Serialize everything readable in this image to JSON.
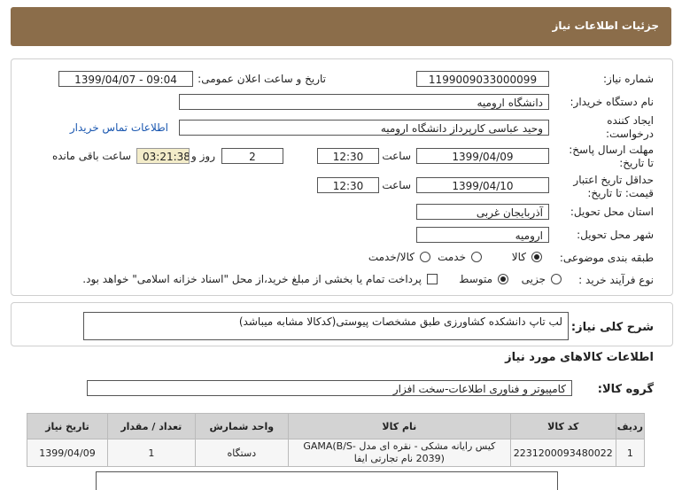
{
  "page": {
    "title": "جزئیات اطلاعات نیاز"
  },
  "form": {
    "need_number": {
      "label": "شماره نیاز:",
      "value": "1199009033000099"
    },
    "announce_datetime": {
      "label": "تاریخ و ساعت اعلان عمومی:",
      "value": "1399/04/07 - 09:04"
    },
    "buyer_org": {
      "label": "نام دستگاه خریدار:",
      "value": "دانشگاه ارومیه"
    },
    "requester": {
      "label_line1": "ایجاد کننده",
      "label_line2": "درخواست:",
      "value": "وحید عباسی کارپرداز دانشگاه ارومیه"
    },
    "contact_link": "اطلاعات تماس خریدار",
    "reply_deadline": {
      "label_line1": "مهلت ارسال پاسخ:",
      "label_line2": "تا تاریخ:",
      "date": "1399/04/09",
      "time_label": "ساعت",
      "time": "12:30",
      "days": "2",
      "days_label": "روز و",
      "remaining": "03:21:38",
      "remaining_label": "ساعت باقی مانده"
    },
    "price_validity": {
      "label_line1": "حداقل تاریخ اعتبار",
      "label_line2": "قیمت: تا تاریخ:",
      "date": "1399/04/10",
      "time_label": "ساعت",
      "time": "12:30"
    },
    "province": {
      "label": "استان محل تحویل:",
      "value": "آذربایجان غربی"
    },
    "city": {
      "label": "شهر محل تحویل:",
      "value": "ارومیه"
    },
    "category": {
      "label": "طبقه بندی موضوعی:",
      "options": [
        "کالا",
        "خدمت",
        "کالا/خدمت"
      ],
      "selected": "کالا"
    },
    "purchase_type": {
      "label": "نوع فرآیند خرید :",
      "options": [
        "جزیی",
        "متوسط"
      ],
      "selected": "متوسط",
      "note": "پرداخت تمام یا بخشی از مبلغ خرید،از محل \"اسناد خزانه اسلامی\" خواهد بود."
    }
  },
  "summary": {
    "label": "شرح کلی نیاز:",
    "value": "لب تاپ دانشکده کشاورزی طبق مشخصات پیوستی(کدکالا مشابه میباشد)"
  },
  "goods_section": {
    "title": "اطلاعات کالاهای مورد نیاز",
    "group_label": "گروه کالا:",
    "group_value": "کامپیوتر و فناوری اطلاعات-سخت افزار"
  },
  "table": {
    "headers": [
      "ردیف",
      "کد کالا",
      "نام کالا",
      "واحد شمارش",
      "تعداد / مقدار",
      "تاریخ نیاز"
    ],
    "rows": [
      {
        "row": "1",
        "code": "2231200093480022",
        "name": "کیس رایانه مشکی - نقره ای مدل GAMA(B/S-2039) نام تجارتی ایفا",
        "unit": "دستگاه",
        "qty": "1",
        "date": "1399/04/09"
      }
    ]
  }
}
